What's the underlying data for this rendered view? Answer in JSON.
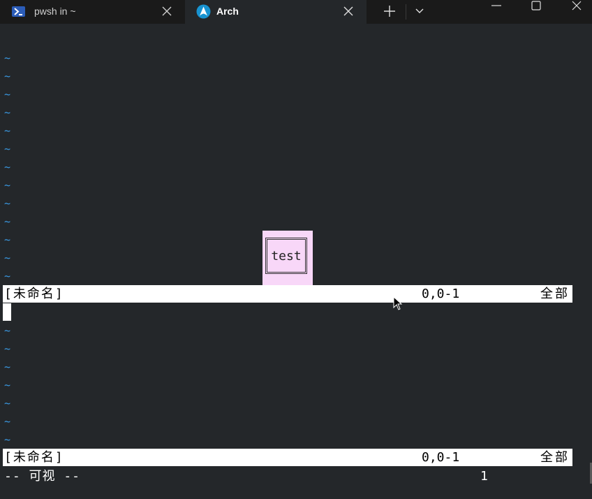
{
  "tabs": [
    {
      "label": "pwsh in ~",
      "icon": "powershell-icon",
      "active": false
    },
    {
      "label": "Arch",
      "icon": "arch-linux-icon",
      "active": true
    }
  ],
  "colors": {
    "background": "#24272a",
    "tilde": "#3a9be6",
    "popup": "#f8d7f8",
    "statusbar": "#ffffff"
  },
  "editor": {
    "tilde": "~",
    "top_window": {
      "status_name": "[未命名]",
      "status_pos": "0,0-1",
      "status_scroll": "全部"
    },
    "bottom_window": {
      "status_name": "[未命名]",
      "status_pos": "0,0-1",
      "status_scroll": "全部"
    },
    "mode": "-- 可视 --",
    "selection_count": "1"
  },
  "popup": {
    "text": "test"
  }
}
